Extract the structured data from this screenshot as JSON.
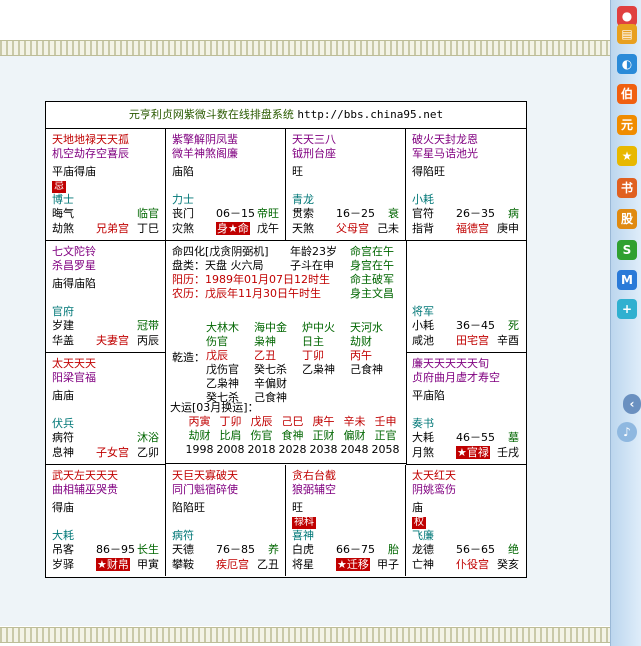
{
  "title_text": "元亨利贞网紫微斗数在线排盘系统",
  "title_url": "http://bbs.china95.net",
  "sidebar_icons": [
    "tv-icon",
    "globe-icon",
    "bo-icon",
    "yuan-icon",
    "star-icon",
    "book-icon",
    "stock-icon",
    "s-icon",
    "m-icon",
    "plus-icon"
  ],
  "cells": {
    "c11": {
      "stars1": "天地地禄天天孤",
      "stars2": "机空劫存空喜辰",
      "bright": "平庙得庙",
      "badge": "忌",
      "god": "博士",
      "r1l": "晦气",
      "r1r": "临官",
      "r2l": "劫煞",
      "r2m": "兄弟宫",
      "r2r": "丁巳"
    },
    "c12": {
      "stars1": "紫擎解阴凤蜚",
      "stars2": "微羊神煞阁廉",
      "bright": "庙陷",
      "god": "力士",
      "r1l": "丧门",
      "r1m": "06－15",
      "r1r": "帝旺",
      "r2l": "灾煞",
      "r2m": "身★命",
      "r2r": "戊午"
    },
    "c13": {
      "stars1": "天天三八",
      "stars2": "钺刑台座",
      "bright": "旺",
      "god": "青龙",
      "r1l": "贯索",
      "r1m": "16－25",
      "r1r": "衰",
      "r2l": "天煞",
      "r2m": "父母宫",
      "r2r": "己未"
    },
    "c14": {
      "stars1": "破火天封龙恩",
      "stars2": "军星马诰池光",
      "bright": "得陷旺",
      "god": "小耗",
      "r1l": "官符",
      "r1m": "26－35",
      "r1r": "病",
      "r2l": "指背",
      "r2m": "福德宫",
      "r2r": "庚申"
    },
    "c21": {
      "stars1": "七文陀铃",
      "stars2": "杀昌罗星",
      "bright": "庙得庙陷",
      "god": "官府",
      "r1l": "岁建",
      "r1r": "冠带",
      "r2l": "华盖",
      "r2m": "夫妻宫",
      "r2r": "丙辰"
    },
    "c24": {
      "god": "将军",
      "r1l": "小耗",
      "r1m": "36－45",
      "r1r": "死",
      "r2l": "咸池",
      "r2m": "田宅宫",
      "r2r": "辛酉"
    },
    "c31": {
      "stars1": "太天天天",
      "stars2": "阳梁官福",
      "bright": "庙庙",
      "god": "伏兵",
      "r1l": "病符",
      "r1r": "沐浴",
      "r2l": "息神",
      "r2m": "子女宫",
      "r2r": "乙卯"
    },
    "c34": {
      "stars1": "廉天天天天天旬",
      "stars2": "贞府曲月虚才寿空",
      "bright": "平庙陷",
      "god": "奏书",
      "r1l": "大耗",
      "r1m": "46－55",
      "r1r": "墓",
      "r2l": "月煞",
      "r2m": "★官禄",
      "r2r": "壬戌"
    },
    "c41": {
      "stars1": "武天左天天天",
      "stars2": "曲相辅巫哭贵",
      "bright": "得庙",
      "god": "大耗",
      "r1l": "吊客",
      "r1m": "86－95",
      "r1r": "长生",
      "r2l": "岁驿",
      "r2m": "★财帛",
      "r2r": "甲寅"
    },
    "c42": {
      "stars1": "天巨天寡破天",
      "stars2": "同门魁宿碎使",
      "bright": "陷陷旺",
      "god": "病符",
      "r1l": "天德",
      "r1m": "76－85",
      "r1r": "养",
      "r2l": "攀鞍",
      "r2m": "疾厄宫",
      "r2r": "乙丑"
    },
    "c43": {
      "stars1": "贪右台截",
      "stars2": "狼弼辅空",
      "bright": "旺",
      "badge": "禄科",
      "god": "喜神",
      "r1l": "白虎",
      "r1m": "66－75",
      "r1r": "胎",
      "r2l": "将星",
      "r2m": "★迁移",
      "r2r": "甲子"
    },
    "c44": {
      "stars1": "太天红天",
      "stars2": "阴姚鸾伤",
      "bright": "庙",
      "badge": "权",
      "god": "飞廉",
      "r1l": "龙德",
      "r1m": "56－65",
      "r1r": "绝",
      "r2l": "亡神",
      "r2m": "仆役宫",
      "r2r": "癸亥"
    }
  },
  "center": {
    "l1a": "命四化[戊贪阴弼机]",
    "l1b": "年龄23岁",
    "l1c": "命宫在午",
    "l2a": "盘类：天盘  火六局",
    "l2b": "子斗在申",
    "l2c": "身宫在午",
    "l3a": "阳历：1989年01月07日12时生",
    "l3c": "命主破军",
    "l4a": "农历：戊辰年11月30日午时生",
    "l4c": "身主文昌",
    "g_row1": [
      "大林木",
      "海中金",
      "炉中火",
      "天河水"
    ],
    "g_row2": [
      "伤官",
      "枭神",
      "日主",
      "劫财"
    ],
    "ganzhi_label": "乾造：",
    "g_row3": [
      "戊辰",
      "乙丑",
      "丁卯",
      "丙午"
    ],
    "g_row4": [
      "戊伤官",
      "癸七杀",
      "乙枭神",
      "己食神"
    ],
    "g_row5": [
      "乙枭神",
      "辛偏财",
      "",
      ""
    ],
    "g_row6": [
      "癸七杀",
      "己食神",
      "",
      ""
    ],
    "dayun_label": "大运[03月换运]：",
    "dy_gz": [
      "丙寅",
      "丁卯",
      "戊辰",
      "己巳",
      "庚午",
      "辛未",
      "壬申"
    ],
    "dy_god": [
      "劫财",
      "比肩",
      "伤官",
      "食神",
      "正财",
      "偏财",
      "正官"
    ],
    "dy_year": [
      "1998",
      "2008",
      "2018",
      "2028",
      "2038",
      "2048",
      "2058"
    ]
  }
}
